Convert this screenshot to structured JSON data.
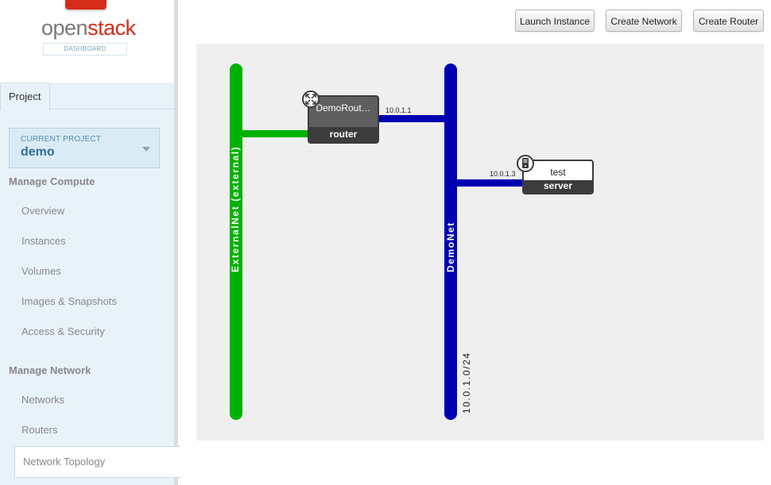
{
  "brand": {
    "name_part1": "open",
    "name_part2": "stack",
    "subtitle": "DASHBOARD"
  },
  "sidebar": {
    "tab_label": "Project",
    "current_project": {
      "label": "CURRENT PROJECT",
      "value": "demo"
    },
    "compute": {
      "heading": "Manage Compute",
      "items": [
        "Overview",
        "Instances",
        "Volumes",
        "Images & Snapshots",
        "Access & Security"
      ]
    },
    "network": {
      "heading": "Manage Network",
      "items": [
        "Networks",
        "Routers"
      ],
      "active_item": "Network Topology"
    }
  },
  "toolbar": {
    "launch_instance": "Launch Instance",
    "create_network": "Create Network",
    "create_router": "Create Router"
  },
  "topology": {
    "networks": [
      {
        "name": "ExternalNet (external)",
        "color": "#00b200",
        "cidr": ""
      },
      {
        "name": "DemoNet",
        "color": "#0000b2",
        "cidr": "10.0.1.0/24"
      }
    ],
    "router": {
      "name": "DemoRout…",
      "type": "router",
      "ip_internal": "10.0.1.1"
    },
    "server": {
      "name": "test",
      "type": "server",
      "ip": "10.0.1.3"
    },
    "icons": {
      "router": "router-expand-icon",
      "server": "server-icon"
    }
  }
}
